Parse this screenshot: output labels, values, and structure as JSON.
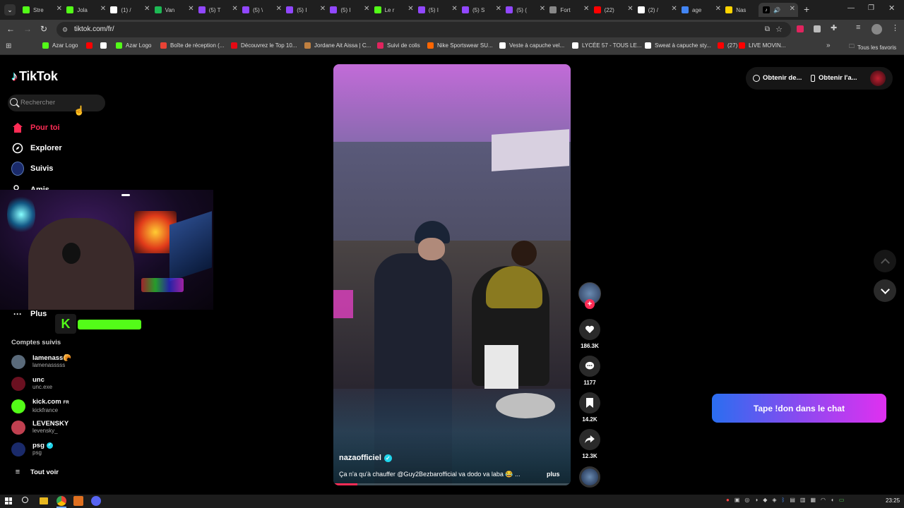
{
  "tabs": [
    {
      "label": "Stre",
      "color": "#53fc18"
    },
    {
      "label": "Jola",
      "color": "#53fc18"
    },
    {
      "label": "(1) /",
      "color": "#ffffff"
    },
    {
      "label": "Van",
      "color": "#1db954"
    },
    {
      "label": "(5) T",
      "color": "#9147ff"
    },
    {
      "label": "(5) \\",
      "color": "#9147ff"
    },
    {
      "label": "(5) I",
      "color": "#9147ff"
    },
    {
      "label": "(5) I",
      "color": "#9147ff"
    },
    {
      "label": "Le r",
      "color": "#53fc18"
    },
    {
      "label": "(5) I",
      "color": "#9147ff"
    },
    {
      "label": "(5) S",
      "color": "#9147ff"
    },
    {
      "label": "(5) (",
      "color": "#9147ff"
    },
    {
      "label": "Fort",
      "color": "#888888"
    },
    {
      "label": "(22)",
      "color": "#ff0000"
    },
    {
      "label": "(2) /",
      "color": "#ffffff"
    },
    {
      "label": "age",
      "color": "#4285f4"
    },
    {
      "label": "Nas",
      "color": "#ffd400"
    }
  ],
  "url": "tiktok.com/fr/",
  "bookmarks": [
    {
      "label": "Azar Logo",
      "color": "#53fc18"
    },
    {
      "label": "",
      "color": "#ff0000"
    },
    {
      "label": "",
      "color": "#ffffff"
    },
    {
      "label": "Azar Logo",
      "color": "#53fc18"
    },
    {
      "label": "Boîte de réception (...",
      "color": "#ea4335"
    },
    {
      "label": "Découvrez le Top 10...",
      "color": "#e50914"
    },
    {
      "label": "Jordane Ait Aissa | C...",
      "color": "#c08040"
    },
    {
      "label": "Suivi de colis",
      "color": "#e0245e"
    },
    {
      "label": "Nike Sportswear SU...",
      "color": "#ff6600"
    },
    {
      "label": "Veste à capuche vel...",
      "color": "#ffffff"
    },
    {
      "label": "LYCÉE 57 - TOUS LE...",
      "color": "#ffffff"
    },
    {
      "label": "Sweat à capuche sty...",
      "color": "#ffffff"
    },
    {
      "label": "(27)",
      "color": "#ff0000"
    },
    {
      "label": "LIVE MOVIN...",
      "color": "#ff0000"
    }
  ],
  "bookmarks_all": "Tous les favoris",
  "logo": "TikTok",
  "search_placeholder": "Rechercher",
  "nav": {
    "for_you": "Pour toi",
    "explore": "Explorer",
    "following": "Suivis",
    "friends": "Amis",
    "more": "Plus"
  },
  "accent": "#fe2c55",
  "following_title": "Comptes suivis",
  "accounts": [
    {
      "name": "lamenass🥐",
      "handle": "lamenasssss",
      "color": "#5a6a7a"
    },
    {
      "name": "unc",
      "handle": "unc.exe",
      "color": "#6a1020"
    },
    {
      "name": "kick.com",
      "suffix": "FR",
      "handle": "kickfrance",
      "color": "#53fc18"
    },
    {
      "name": "LEVENSKY",
      "handle": "levensky_",
      "color": "#c04050"
    },
    {
      "name": "psg",
      "handle": "psg",
      "color": "#1a2a6a"
    }
  ],
  "see_all": "Tout voir",
  "header_buttons": {
    "get_coins": "Obtenir de...",
    "get_app": "Obtenir l'a..."
  },
  "video": {
    "author": "nazaofficiel",
    "caption": "Ça n'a qu'à chauffer @Guy2Bezbarofficial va dodo va laba 😂 ...",
    "more": "plus"
  },
  "actions": {
    "likes": "186.3K",
    "comments": "1177",
    "saves": "14.2K",
    "shares": "12.3K"
  },
  "overlay_cta": "Tape !don dans le chat",
  "clock": "23:25"
}
